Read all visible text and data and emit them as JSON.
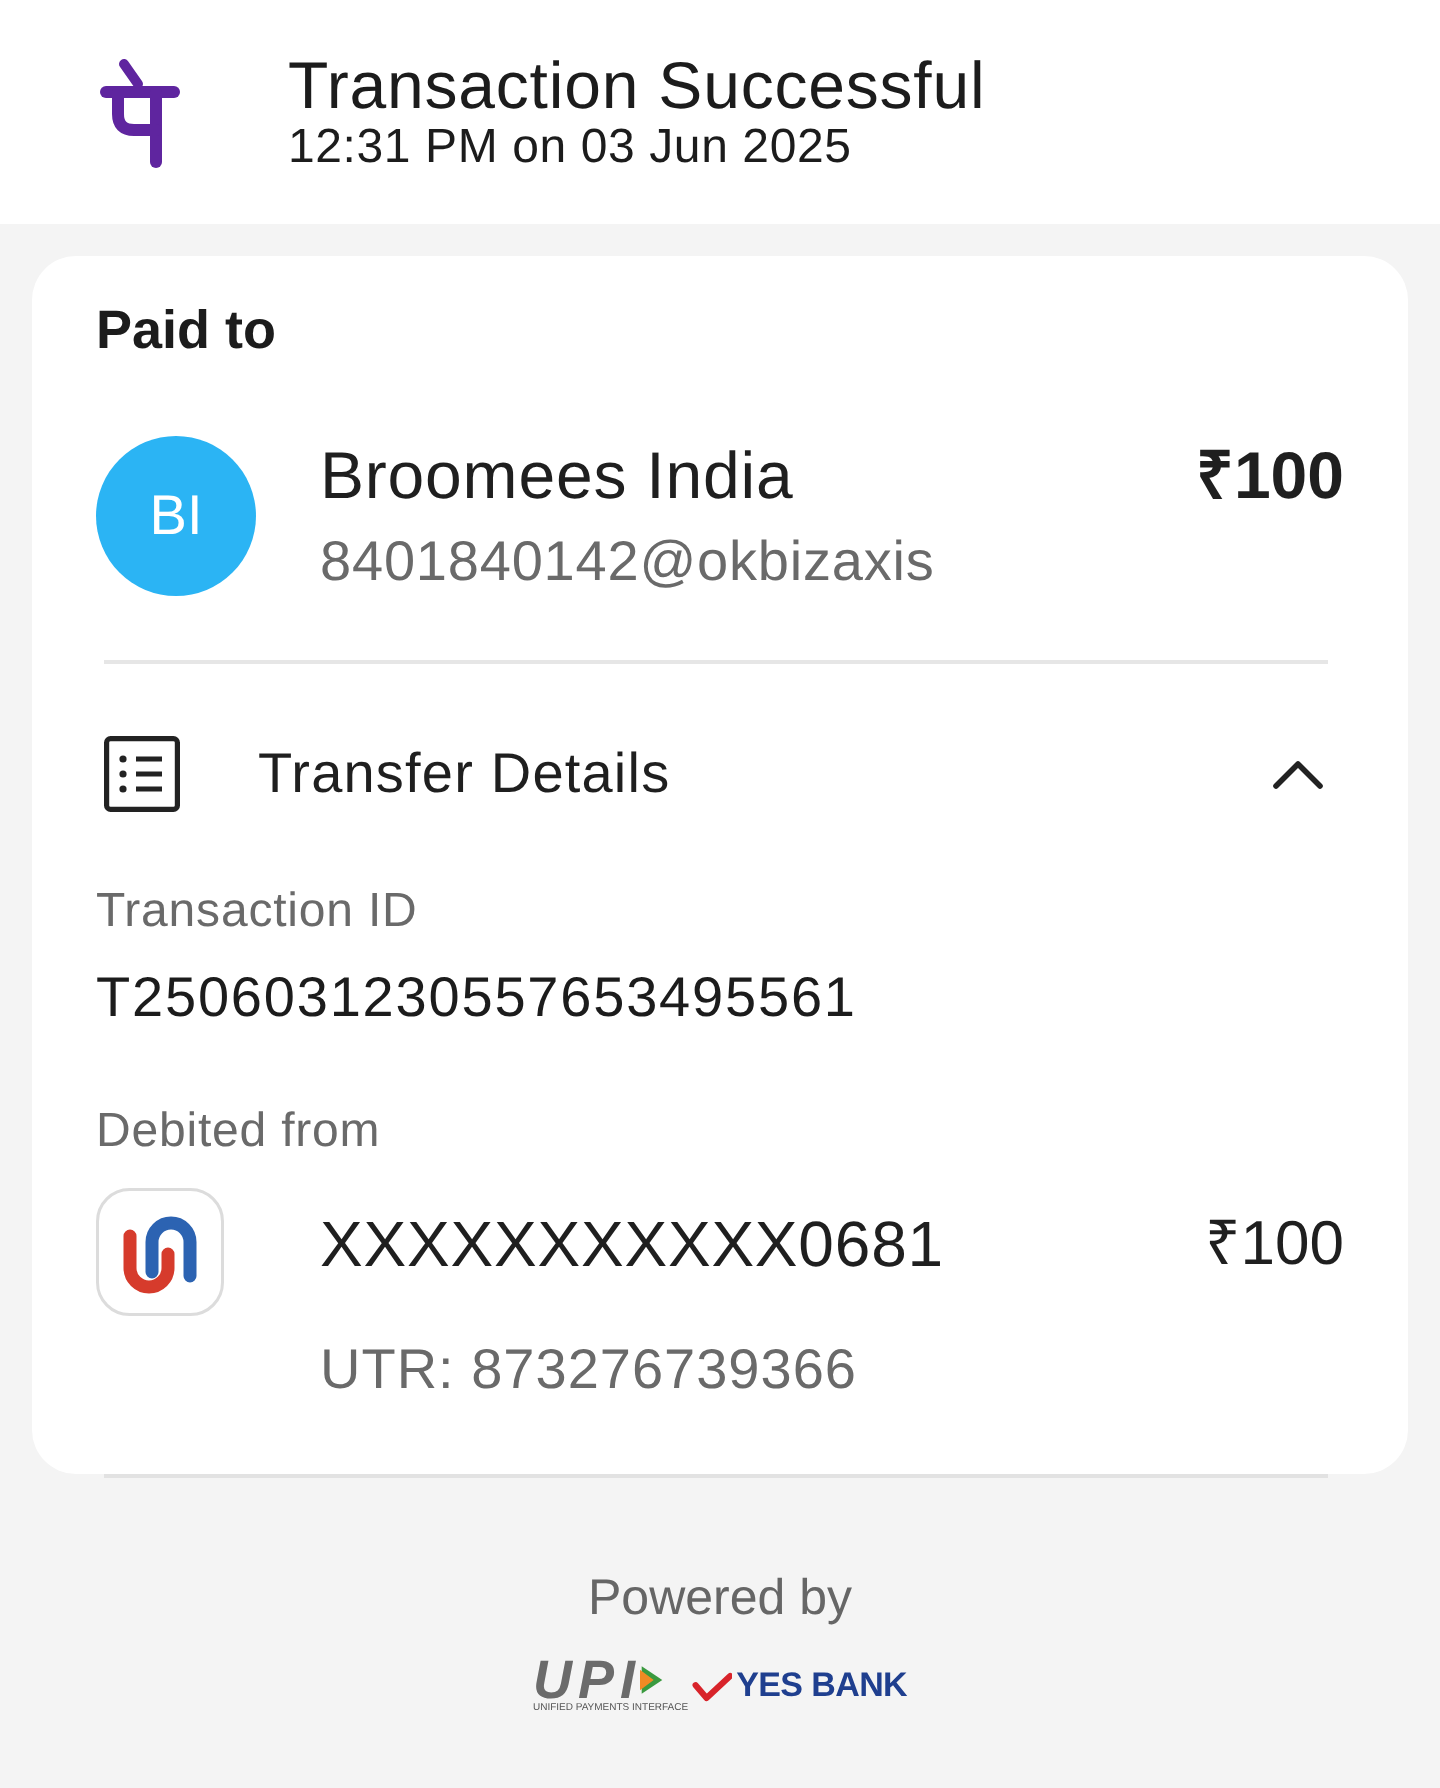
{
  "header": {
    "title": "Transaction Successful",
    "timestamp": "12:31 PM on 03 Jun 2025"
  },
  "paid_to": {
    "heading": "Paid to",
    "avatar_initials": "BI",
    "name": "Broomees India",
    "upi_id": "8401840142@okbizaxis",
    "amount": "₹100"
  },
  "transfer_details": {
    "title": "Transfer Details",
    "expanded": true,
    "transaction_id": {
      "label": "Transaction ID",
      "value": "T2506031230557653495561"
    },
    "debited_from": {
      "label": "Debited from",
      "account": "XXXXXXXXXXX0681",
      "amount": "₹100",
      "utr": "UTR: 873276739366"
    }
  },
  "footer": {
    "powered_by": "Powered by",
    "upi_logo": "UPI",
    "upi_tagline": "UNIFIED PAYMENTS INTERFACE",
    "bank_logo": "YES BANK"
  }
}
